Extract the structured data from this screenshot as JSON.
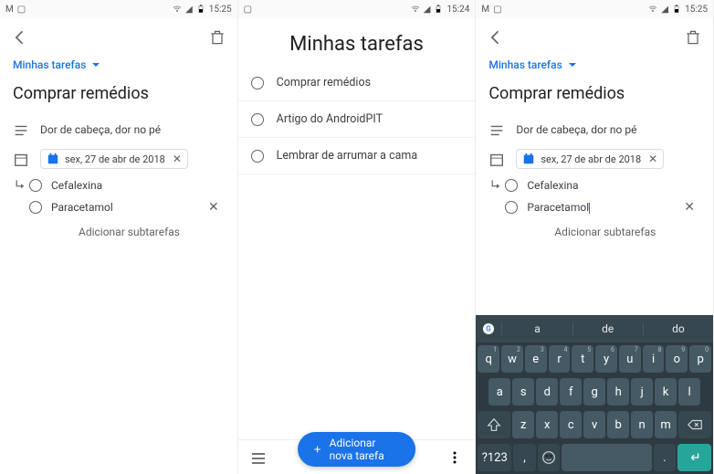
{
  "status": {
    "time1": "15:25",
    "time2": "15:24",
    "time3": "15:25"
  },
  "detail": {
    "list_label": "Minhas tarefas",
    "title": "Comprar remédios",
    "description": "Dor de cabeça, dor no pé",
    "date_chip": "sex, 27 de abr de 2018",
    "subtasks": [
      "Cefalexina",
      "Paracetamol"
    ],
    "add_subtask": "Adicionar subtarefas"
  },
  "list": {
    "title": "Minhas tarefas",
    "tasks": [
      "Comprar remédios",
      "Artigo do AndroidPIT",
      "Lembrar de arrumar a cama"
    ],
    "fab": "Adicionar nova tarefa"
  },
  "keyboard": {
    "suggestions": [
      "a",
      "de",
      "do"
    ],
    "row1": [
      "q",
      "w",
      "e",
      "r",
      "t",
      "y",
      "u",
      "i",
      "o",
      "p"
    ],
    "nums": [
      "1",
      "2",
      "3",
      "4",
      "5",
      "6",
      "7",
      "8",
      "9",
      "0"
    ],
    "row2": [
      "a",
      "s",
      "d",
      "f",
      "g",
      "h",
      "j",
      "k",
      "l"
    ],
    "row3": [
      "z",
      "x",
      "c",
      "v",
      "b",
      "n",
      "m"
    ],
    "sym": "?123"
  }
}
